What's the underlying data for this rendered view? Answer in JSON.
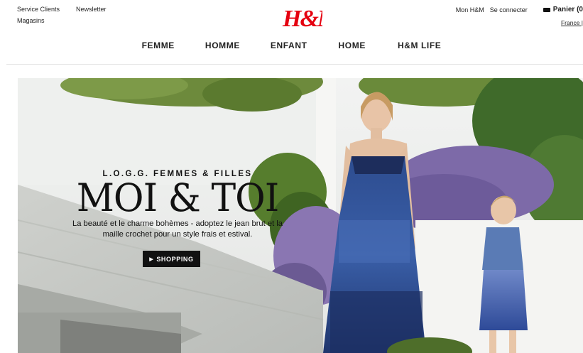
{
  "header": {
    "left_row1": [
      "Service Clients",
      "Newsletter"
    ],
    "left_row2": "Magasins",
    "logo_text": "H&M",
    "right": {
      "account": "Mon H&M",
      "login": "Se connecter",
      "cart": "Panier (0",
      "lang": "France | "
    }
  },
  "nav": {
    "items": [
      "FEMME",
      "HOMME",
      "ENFANT",
      "HOME",
      "H&M LIFE"
    ]
  },
  "hero": {
    "eyebrow": "L.O.G.G. FEMMES & FILLES",
    "headline": "MOI & TOI",
    "sub": "La beauté et le charme bohèmes - adoptez le jean brut et la maille crochet pour un style frais et estival.",
    "cta": "SHOPPING"
  },
  "colors": {
    "brand_red": "#e50010",
    "text": "#222222",
    "button_bg": "#111111"
  },
  "icons": [
    "cart-icon",
    "caret-right-icon"
  ]
}
